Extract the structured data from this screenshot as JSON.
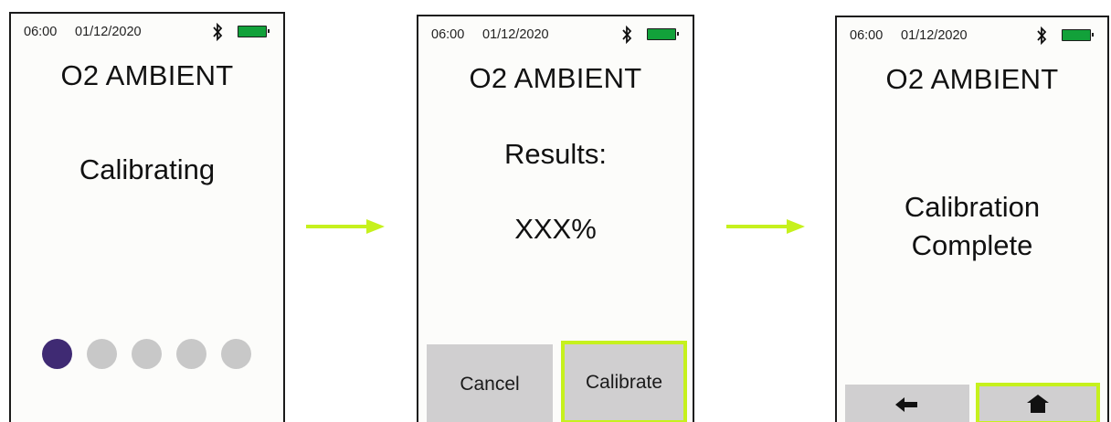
{
  "screens": [
    {
      "status": {
        "time": "06:00",
        "date": "01/12/2020",
        "bluetooth_icon": "bluetooth-icon",
        "battery_icon": "battery-icon"
      },
      "title": "O2 AMBIENT",
      "message": "Calibrating",
      "progress": {
        "total_steps": 5,
        "current_step": 1
      }
    },
    {
      "status": {
        "time": "06:00",
        "date": "01/12/2020",
        "bluetooth_icon": "bluetooth-icon",
        "battery_icon": "battery-icon"
      },
      "title": "O2 AMBIENT",
      "results_label": "Results:",
      "results_value": "XXX%",
      "buttons": {
        "cancel": "Cancel",
        "calibrate": "Calibrate"
      }
    },
    {
      "status": {
        "time": "06:00",
        "date": "01/12/2020",
        "bluetooth_icon": "bluetooth-icon",
        "battery_icon": "battery-icon"
      },
      "title": "O2 AMBIENT",
      "message_line1": "Calibration",
      "message_line2": "Complete",
      "buttons": {
        "back_icon": "arrow-left-icon",
        "home_icon": "home-icon"
      }
    }
  ],
  "colors": {
    "highlight": "#c6f11d",
    "arrow": "#c6f11d",
    "battery": "#12a13a",
    "progress_active": "#3f2a73",
    "progress_inactive": "#c8c8c8",
    "button_bg": "#d0cfd0"
  }
}
